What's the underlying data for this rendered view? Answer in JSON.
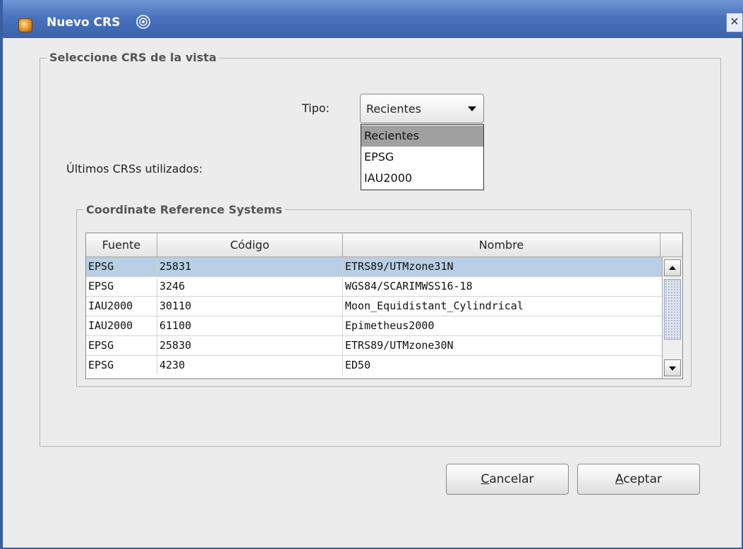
{
  "window": {
    "title": "Nuevo CRS"
  },
  "group_view": {
    "legend": "Seleccione CRS de la vista"
  },
  "tipo": {
    "label": "Tipo:",
    "selected": "Recientes",
    "options": [
      "Recientes",
      "EPSG",
      "IAU2000"
    ]
  },
  "recent_label": "Últimos CRSs utilizados:",
  "crs_group": {
    "legend": "Coordinate Reference Systems"
  },
  "table": {
    "columns": [
      "Fuente",
      "Código",
      "Nombre"
    ],
    "rows": [
      [
        "EPSG",
        "25831",
        "ETRS89/UTMzone31N"
      ],
      [
        "EPSG",
        "3246",
        "WGS84/SCARIMWSS16-18"
      ],
      [
        "IAU2000",
        "30110",
        "Moon_Equidistant_Cylindrical"
      ],
      [
        "IAU2000",
        "61100",
        "Epimetheus2000"
      ],
      [
        "EPSG",
        "25830",
        "ETRS89/UTMzone30N"
      ],
      [
        "EPSG",
        "4230",
        "ED50"
      ]
    ],
    "selected_row": 0
  },
  "buttons": {
    "cancel": {
      "mnemonic": "C",
      "rest": "ancelar"
    },
    "accept": {
      "mnemonic": "A",
      "rest": "ceptar"
    }
  },
  "colors": {
    "titlebar": "#4a72bd",
    "selection": "#b8cfe5",
    "dropdown_selection": "#a0a0a0"
  },
  "icons": [
    "app-icon",
    "title-swirl-icon",
    "close-icon",
    "scroll-up-icon",
    "scroll-down-icon",
    "dropdown-arrow-icon"
  ]
}
